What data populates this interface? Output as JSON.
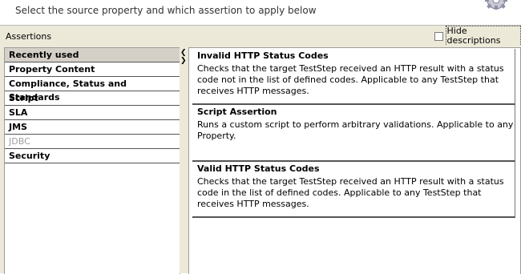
{
  "header": {
    "subtitle": "Select the source property and which assertion to apply below",
    "icon": "gear-icon"
  },
  "toolbar": {
    "title": "Assertions",
    "hide_descriptions_label": "Hide descriptions",
    "hide_descriptions_checked": false
  },
  "categories": [
    {
      "label": "Recently used",
      "selected": true,
      "enabled": true
    },
    {
      "label": "Property Content",
      "selected": false,
      "enabled": true
    },
    {
      "label": "Compliance, Status and Standards",
      "selected": false,
      "enabled": true
    },
    {
      "label": "Script",
      "selected": false,
      "enabled": true
    },
    {
      "label": "SLA",
      "selected": false,
      "enabled": true
    },
    {
      "label": "JMS",
      "selected": false,
      "enabled": true
    },
    {
      "label": "JDBC",
      "selected": false,
      "enabled": false
    },
    {
      "label": "Security",
      "selected": false,
      "enabled": true
    }
  ],
  "assertions": [
    {
      "name": "Invalid HTTP Status Codes",
      "description": "Checks that the target TestStep received an HTTP result with a status code not in the list of defined codes. Applicable to any TestStep that receives HTTP messages."
    },
    {
      "name": "Script Assertion",
      "description": "Runs a custom script to perform arbitrary validations. Applicable to any Property."
    },
    {
      "name": "Valid HTTP Status Codes",
      "description": "Checks that the target TestStep received an HTTP result with a status code in the list of defined codes. Applicable to any TestStep that receives HTTP messages."
    }
  ],
  "colors": {
    "panel_bg": "#ece9d8",
    "selected_bg": "#d4d0c8",
    "disabled_text": "#a0a0a0"
  }
}
